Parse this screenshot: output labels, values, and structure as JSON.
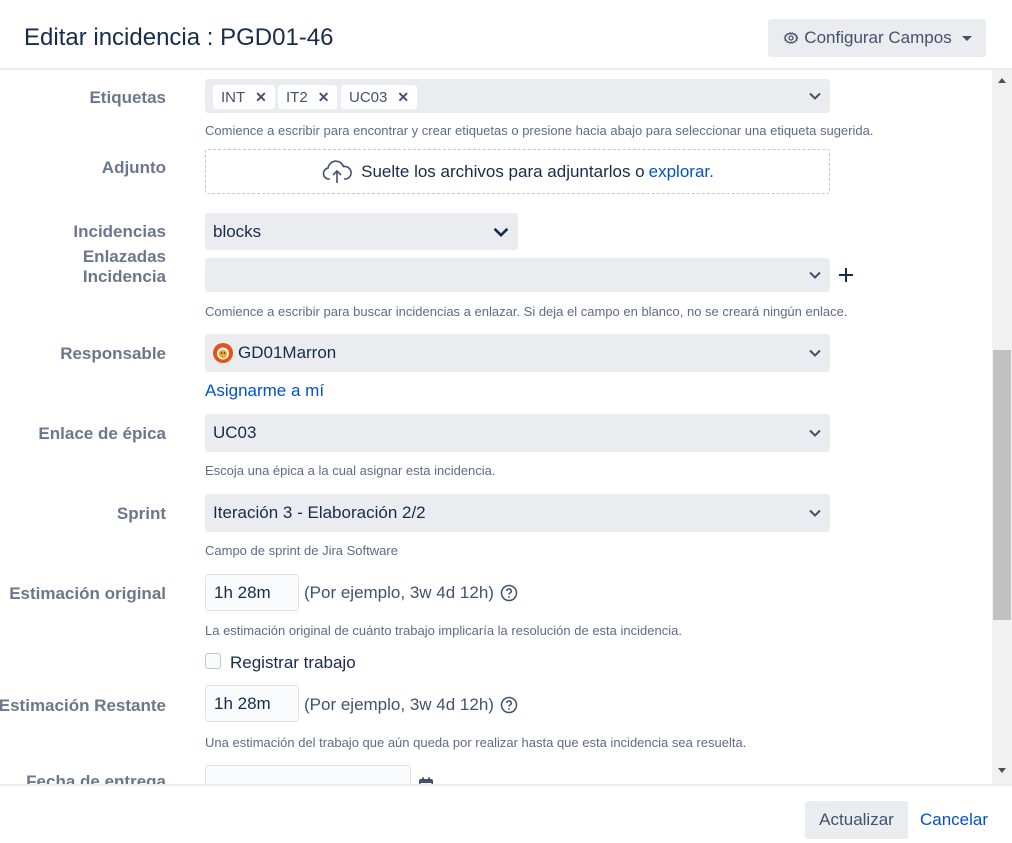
{
  "dialog": {
    "title": "Editar incidencia : PGD01-46",
    "configure_label": "Configurar Campos"
  },
  "fields": {
    "labels": {
      "label": "Etiquetas",
      "tags": [
        "INT",
        "IT2",
        "UC03"
      ],
      "help": "Comience a escribir para encontrar y crear etiquetas o presione hacia abajo para seleccionar una etiqueta sugerida."
    },
    "attachment": {
      "label": "Adjunto",
      "drop_text": "Suelte los archivos para adjuntarlos o",
      "browse_link": "explorar."
    },
    "linked_issues": {
      "label_line1": "Incidencias",
      "label_line2": "Enlazadas",
      "link_type": "blocks",
      "issue_label": "Incidencia",
      "issue_value": "",
      "help": "Comience a escribir para buscar incidencias a enlazar. Si deja el campo en blanco, no se creará ningún enlace."
    },
    "assignee": {
      "label": "Responsable",
      "value": "GD01Marron",
      "assign_me": "Asignarme a mí"
    },
    "epic_link": {
      "label": "Enlace de épica",
      "value": "UC03",
      "help": "Escoja una épica a la cual asignar esta incidencia."
    },
    "sprint": {
      "label": "Sprint",
      "value": "Iteración 3 - Elaboración 2/2",
      "help": "Campo de sprint de Jira Software"
    },
    "original_estimate": {
      "label": "Estimación original",
      "value": "1h 28m",
      "example": "(Por ejemplo, 3w 4d 12h)",
      "help": "La estimación original de cuánto trabajo implicaría la resolución de esta incidencia."
    },
    "log_work": {
      "label": "Registrar trabajo",
      "checked": false
    },
    "remaining_estimate": {
      "label": "Estimación Restante",
      "value": "1h 28m",
      "example": "(Por ejemplo, 3w 4d 12h)",
      "help": "Una estimación del trabajo que aún queda por realizar hasta que esta incidencia sea resuelta."
    },
    "due_date": {
      "label": "Fecha de entrega",
      "value": ""
    }
  },
  "footer": {
    "update_label": "Actualizar",
    "cancel_label": "Cancelar"
  },
  "colors": {
    "link": "#0052cc",
    "field_bg": "#ebecf0",
    "label": "#6b778c",
    "avatar": "#e8521a"
  }
}
